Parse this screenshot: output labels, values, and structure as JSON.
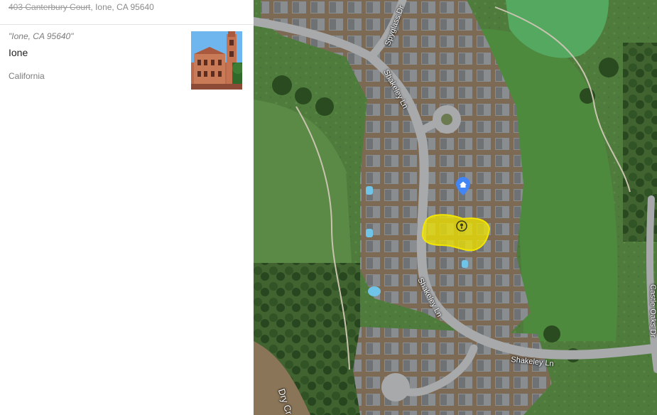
{
  "result": {
    "address_struck": "403 Canterbury Court",
    "address_tail": ", Ione, CA 95640"
  },
  "card": {
    "quote": "\"Ione, CA 95640\"",
    "place": "Ione",
    "state": "California"
  },
  "map": {
    "streets": {
      "spyglass": "Spyglass Dr",
      "shakeley_top": "Shakeley Ln",
      "shakeley_mid": "Shakeley Ln",
      "shakeley_bottom": "Shakeley Ln",
      "castle_oaks": "Castle Oaks Dr",
      "dry_creek": "Dry Cr"
    },
    "highlight_color": "#f2e600",
    "home_pin_color": "#4285f4"
  }
}
